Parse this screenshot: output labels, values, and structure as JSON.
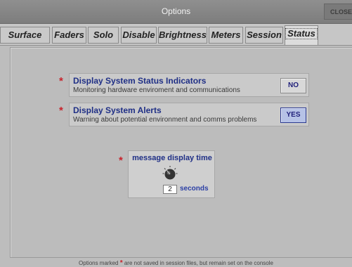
{
  "window": {
    "title": "Options",
    "close_label": "CLOSE"
  },
  "tabs": [
    {
      "label": "Surface",
      "active": false
    },
    {
      "label": "Faders",
      "active": false
    },
    {
      "label": "Solo",
      "active": false
    },
    {
      "label": "Disable",
      "active": false
    },
    {
      "label": "Brightness",
      "active": false
    },
    {
      "label": "Meters",
      "active": false
    },
    {
      "label": "Session",
      "active": false
    },
    {
      "label": "Status",
      "active": true
    }
  ],
  "options": [
    {
      "marker": "*",
      "title": "Display System Status Indicators",
      "description": "Monitoring hardware enviroment and communications",
      "value": "NO"
    },
    {
      "marker": "*",
      "title": "Display System Alerts",
      "description": "Warning about potential environment and comms problems",
      "value": "YES"
    }
  ],
  "message_display_time": {
    "marker": "*",
    "label": "message display time",
    "value": "2",
    "unit": "seconds"
  },
  "footer": {
    "prefix": "Options marked",
    "marker": "*",
    "suffix": "are not saved in session files, but remain set on the console"
  },
  "colors": {
    "accent_blue": "#1f2f86",
    "marker_red": "#c8232c",
    "yes_fill": "#b6c2e6"
  }
}
